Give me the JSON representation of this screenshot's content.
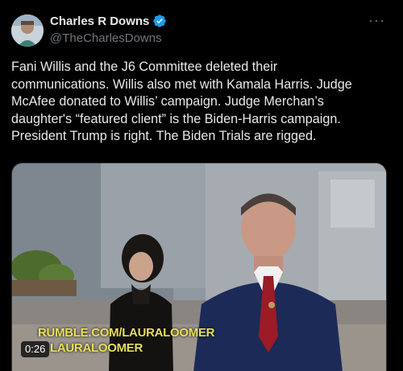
{
  "author": {
    "name": "Charles R Downs",
    "handle": "@TheCharlesDowns",
    "verified_icon": "verified-badge-icon",
    "more_icon": "more-options-icon"
  },
  "tweet": {
    "lines": [
      "Fani Willis and the J6 Committee deleted their",
      "communications. Willis also met with Kamala Harris. Judge",
      "McAfee donated to Willis’ campaign. Judge Merchan’s",
      "daughter's “featured client” is the Biden-Harris campaign.",
      "President Trump is right. The Biden Trials are rigged."
    ]
  },
  "video": {
    "duration": "0:26",
    "watermark_line1": "RUMBLE.COM/LAURALOOMER",
    "watermark_line2": "LAURALOOMER"
  },
  "colors": {
    "background": "#000000",
    "text": "#e7e9ea",
    "muted": "#71767b",
    "verified": "#1d9bf0",
    "watermark": "#e8df5a"
  }
}
